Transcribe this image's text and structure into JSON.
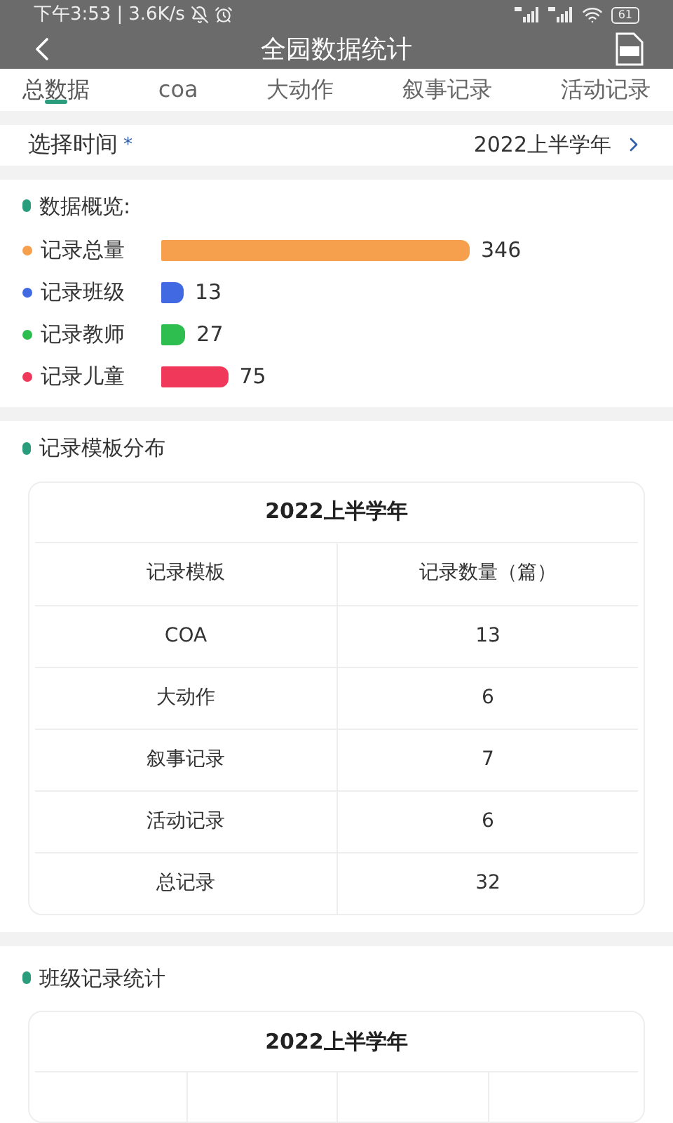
{
  "status_bar": {
    "time": "下午3:53",
    "divider": "|",
    "speed": "3.6K/s",
    "battery": "61"
  },
  "header": {
    "title": "全园数据统计"
  },
  "tabs": [
    {
      "label": "总数据",
      "selected": true
    },
    {
      "label": "coa",
      "selected": false
    },
    {
      "label": "大动作",
      "selected": false
    },
    {
      "label": "叙事记录",
      "selected": false
    },
    {
      "label": "活动记录",
      "selected": false
    }
  ],
  "time_select": {
    "label": "选择时间",
    "required_mark": "*",
    "value": "2022上半学年"
  },
  "overview": {
    "title": "数据概览:",
    "items": [
      {
        "label": "记录总量",
        "value": "346",
        "color": "#f6a04d"
      },
      {
        "label": "记录班级",
        "value": "13",
        "color": "#4169e1"
      },
      {
        "label": "记录教师",
        "value": "27",
        "color": "#2ebd4f"
      },
      {
        "label": "记录儿童",
        "value": "75",
        "color": "#f0395a"
      }
    ]
  },
  "template_section": {
    "title": "记录模板分布",
    "table_title": "2022上半学年",
    "columns": [
      "记录模板",
      "记录数量（篇）"
    ],
    "rows": [
      [
        "COA",
        "13"
      ],
      [
        "大动作",
        "6"
      ],
      [
        "叙事记录",
        "7"
      ],
      [
        "活动记录",
        "6"
      ],
      [
        "总记录",
        "32"
      ]
    ]
  },
  "class_section": {
    "title": "班级记录统计",
    "table_title": "2022上半学年"
  }
}
